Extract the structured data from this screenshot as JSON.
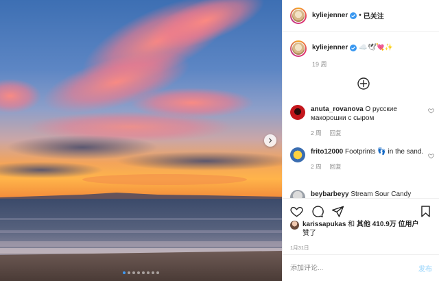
{
  "header": {
    "username": "kyliejenner",
    "separator": "•",
    "follow_state": "已关注"
  },
  "caption": {
    "username": "kyliejenner",
    "emojis": "☁️🕊💘✨",
    "age": "19 周"
  },
  "comments": [
    {
      "username": "anuta_rovanova",
      "text": "О русские макорошки с сыром",
      "age": "2 周",
      "reply_label": "回复"
    },
    {
      "username": "frito12000",
      "text": "Footprints 👣 in the sand.",
      "age": "2 周",
      "reply_label": "回复"
    },
    {
      "username": "beybarbeyy",
      "text": "Stream Sour Candy"
    }
  ],
  "likes": {
    "username": "karissapukas",
    "text_mid": " 和 ",
    "others": "其他 410.9万 位用户",
    "liked": "赞了"
  },
  "post_date": "1月31日",
  "add_comment": {
    "placeholder": "添加评论...",
    "post_label": "发布"
  },
  "carousel": {
    "count": 8,
    "active_index": 0
  },
  "colors": {
    "accent": "#3f9bf5",
    "verified": "#3897f0",
    "post_button_disabled": "#b2dffc",
    "muted_text": "#8e8e8e"
  },
  "icons": [
    "chevron-right-icon",
    "verified-badge-icon",
    "add-circle-icon",
    "heart-icon",
    "comment-icon",
    "share-icon",
    "bookmark-icon"
  ]
}
